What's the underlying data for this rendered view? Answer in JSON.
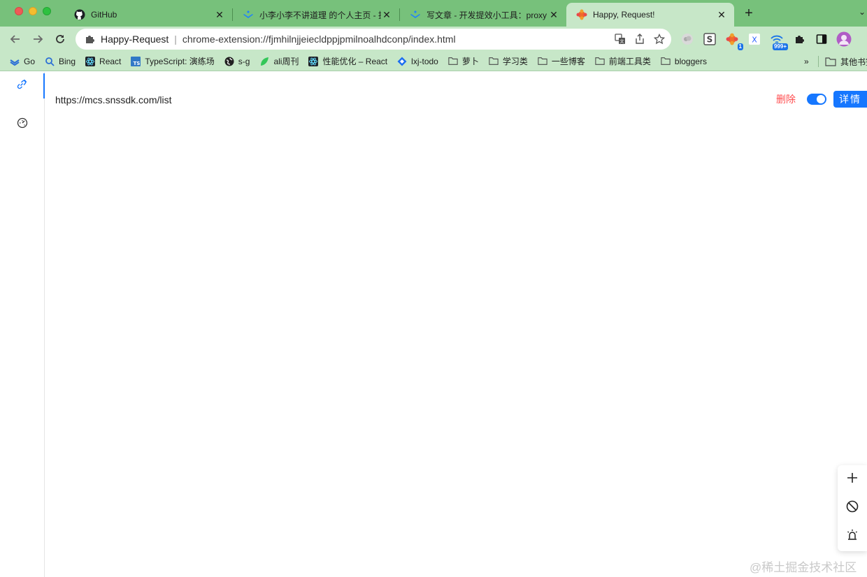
{
  "browser": {
    "tabs": [
      {
        "title": "GitHub",
        "icon": "github-icon",
        "active": false
      },
      {
        "title": "小李小李不讲道理 的个人主页 - 掘金",
        "icon": "juejin-icon",
        "active": false
      },
      {
        "title": "写文章 - 开发提效小工具：proxy",
        "icon": "juejin-icon",
        "active": false
      },
      {
        "title": "Happy, Request!",
        "icon": "happy-request-icon",
        "active": true
      }
    ],
    "address": {
      "origin": "Happy-Request",
      "url": "chrome-extension://fjmhilnjjeiecldppjpmilnoalhdconp/index.html"
    },
    "extensions": {
      "badge_one": "1",
      "badge_many": "999+"
    },
    "bookmarks": [
      {
        "label": "Go",
        "icon": "go-icon"
      },
      {
        "label": "Bing",
        "icon": "search-icon"
      },
      {
        "label": "React",
        "icon": "react-icon"
      },
      {
        "label": "TypeScript: 演练场",
        "icon": "typescript-icon"
      },
      {
        "label": "s-g",
        "icon": "globe-icon"
      },
      {
        "label": "ali周刊",
        "icon": "leaf-icon"
      },
      {
        "label": "性能优化 – React",
        "icon": "react-icon"
      },
      {
        "label": "lxj-todo",
        "icon": "diamond-icon"
      },
      {
        "label": "萝卜",
        "icon": "folder-icon"
      },
      {
        "label": "学习类",
        "icon": "folder-icon"
      },
      {
        "label": "一些博客",
        "icon": "folder-icon"
      },
      {
        "label": "前端工具类",
        "icon": "folder-icon"
      },
      {
        "label": "bloggers",
        "icon": "folder-icon"
      }
    ],
    "bookmarks_overflow": "»",
    "other_bookmarks": "其他书签"
  },
  "app": {
    "rule": {
      "url": "https://mcs.snssdk.com/list",
      "delete_label": "删除",
      "enabled": true,
      "detail_label": "详情"
    }
  },
  "watermark": "@稀土掘金技术社区",
  "colors": {
    "tabstrip": "#77c17b",
    "toolbar": "#c7e7c8",
    "primary": "#1677ff",
    "danger": "#ff4d4f"
  }
}
